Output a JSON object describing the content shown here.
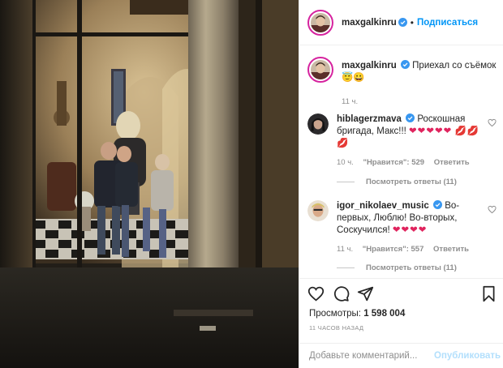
{
  "post": {
    "author": "maxgalkinru",
    "follow_label": "Подписаться",
    "separator": "•",
    "caption": "Приехал со съёмок",
    "caption_emoji": [
      "😇",
      "😀"
    ],
    "caption_time": "11 ч.",
    "view_label": "Просмотры:",
    "views": "1 598 004",
    "time_ago": "11 ЧАСОВ НАЗАД",
    "comment_placeholder": "Добавьте комментарий...",
    "publish_label": "Опубликовать"
  },
  "comments": [
    {
      "user": "hiblagerzmava",
      "text": "Роскошная бригада, Макс!!!",
      "hearts": 5,
      "lips": 3,
      "time": "10 ч.",
      "likes": "\"Нравится\": 529",
      "reply_label": "Ответить",
      "view_replies": "Посмотреть ответы (11)"
    },
    {
      "user": "igor_nikolaev_music",
      "text": "Во-первых, Люблю! Во-вторых, Соскучился!",
      "hearts": 4,
      "time": "11 ч.",
      "likes": "\"Нравится\": 557",
      "reply_label": "Ответить",
      "view_replies": "Посмотреть ответы (11)"
    }
  ],
  "colors": {
    "link_blue": "#0095f6",
    "publish_disabled": "#b2dffc",
    "verified_blue": "#3897f0",
    "muted": "#8e8e8e",
    "heart_red": "#e0245e"
  },
  "icons": [
    "more-icon",
    "heart-icon",
    "comment-icon",
    "share-icon",
    "bookmark-icon",
    "verified-icon"
  ]
}
